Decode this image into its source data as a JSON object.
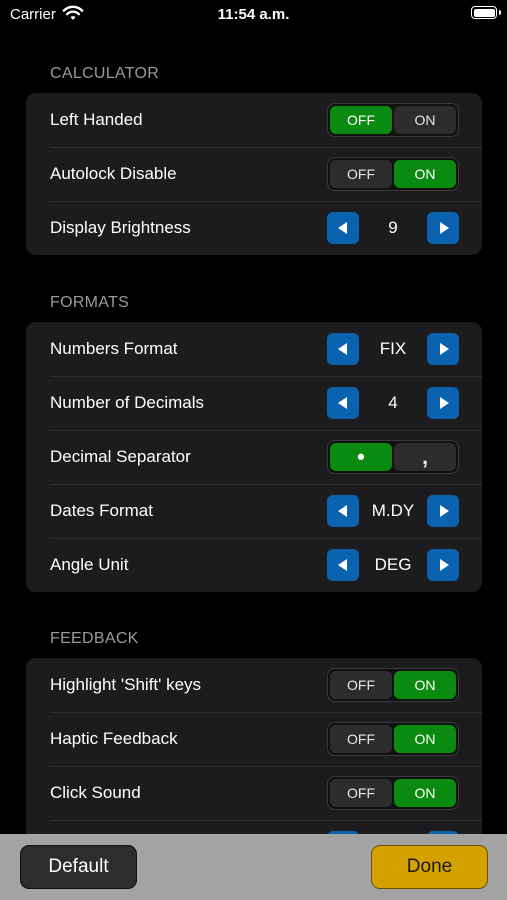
{
  "status_bar": {
    "carrier": "Carrier",
    "time": "11:54 a.m."
  },
  "colors": {
    "active_green": "#0a8a0e",
    "stepper_blue": "#0b63b0",
    "done_yellow": "#d4a100",
    "card_bg": "#1c1c1e"
  },
  "icons": {
    "wifi": "wifi-icon",
    "battery": "battery-icon",
    "prev": "triangle-left-icon",
    "next": "triangle-right-icon"
  },
  "sections": {
    "calculator": {
      "title": "CALCULATOR",
      "left_handed": {
        "label": "Left Handed",
        "off": "OFF",
        "on": "ON",
        "selected": "OFF"
      },
      "autolock": {
        "label": "Autolock Disable",
        "off": "OFF",
        "on": "ON",
        "selected": "ON"
      },
      "brightness": {
        "label": "Display Brightness",
        "value": "9"
      }
    },
    "formats": {
      "title": "FORMATS",
      "numbers_format": {
        "label": "Numbers Format",
        "value": "FIX"
      },
      "decimals": {
        "label": "Number of Decimals",
        "value": "4"
      },
      "separator": {
        "label": "Decimal Separator",
        "dot": "•",
        "comma": ",",
        "selected": "dot"
      },
      "dates_format": {
        "label": "Dates Format",
        "value": "M.DY"
      },
      "angle_unit": {
        "label": "Angle Unit",
        "value": "DEG"
      }
    },
    "feedback": {
      "title": "FEEDBACK",
      "highlight_shift": {
        "label": "Highlight 'Shift' keys",
        "off": "OFF",
        "on": "ON",
        "selected": "ON"
      },
      "haptic": {
        "label": "Haptic Feedback",
        "off": "OFF",
        "on": "ON",
        "selected": "ON"
      },
      "click_sound": {
        "label": "Click Sound",
        "off": "OFF",
        "on": "ON",
        "selected": "ON"
      }
    }
  },
  "bottom_bar": {
    "default_label": "Default",
    "done_label": "Done"
  }
}
